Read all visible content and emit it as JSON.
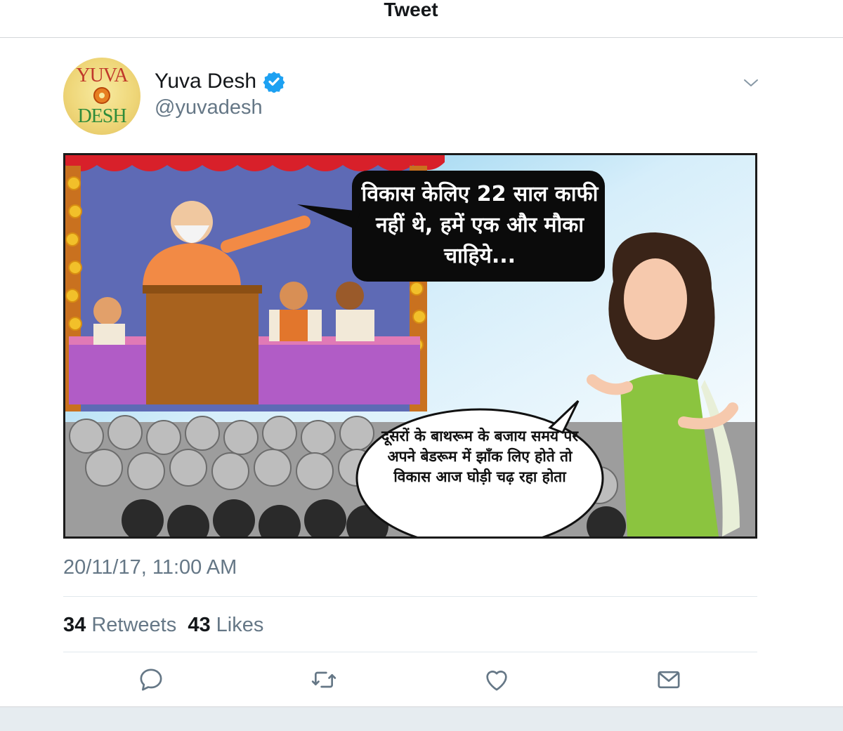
{
  "header": {
    "title": "Tweet"
  },
  "author": {
    "display_name": "Yuva Desh",
    "handle": "@yuvadesh",
    "verified": true,
    "avatar_logo_text": {
      "top": "YUVA",
      "bottom": "DESH"
    }
  },
  "media": {
    "speech_bubble_1": "विकास केलिए 22 साल काफी नहीं थे, हमें एक और मौका चाहिये...",
    "speech_bubble_2": "दूसरों के बाथरूम के बजाय समय पर अपने बेडरूम में झाँक लिए होते तो विकास आज घोड़ी चढ़ रहा होता"
  },
  "timestamp": "20/11/17, 11:00 AM",
  "stats": {
    "retweets_count": "34",
    "retweets_label": "Retweets",
    "likes_count": "43",
    "likes_label": "Likes"
  },
  "actions": [
    "reply-icon",
    "retweet-icon",
    "like-icon",
    "message-icon"
  ],
  "colors": {
    "verified": "#1da1f2",
    "secondary_text": "#657786",
    "icon": "#657786",
    "divider": "#e1e8ed"
  }
}
